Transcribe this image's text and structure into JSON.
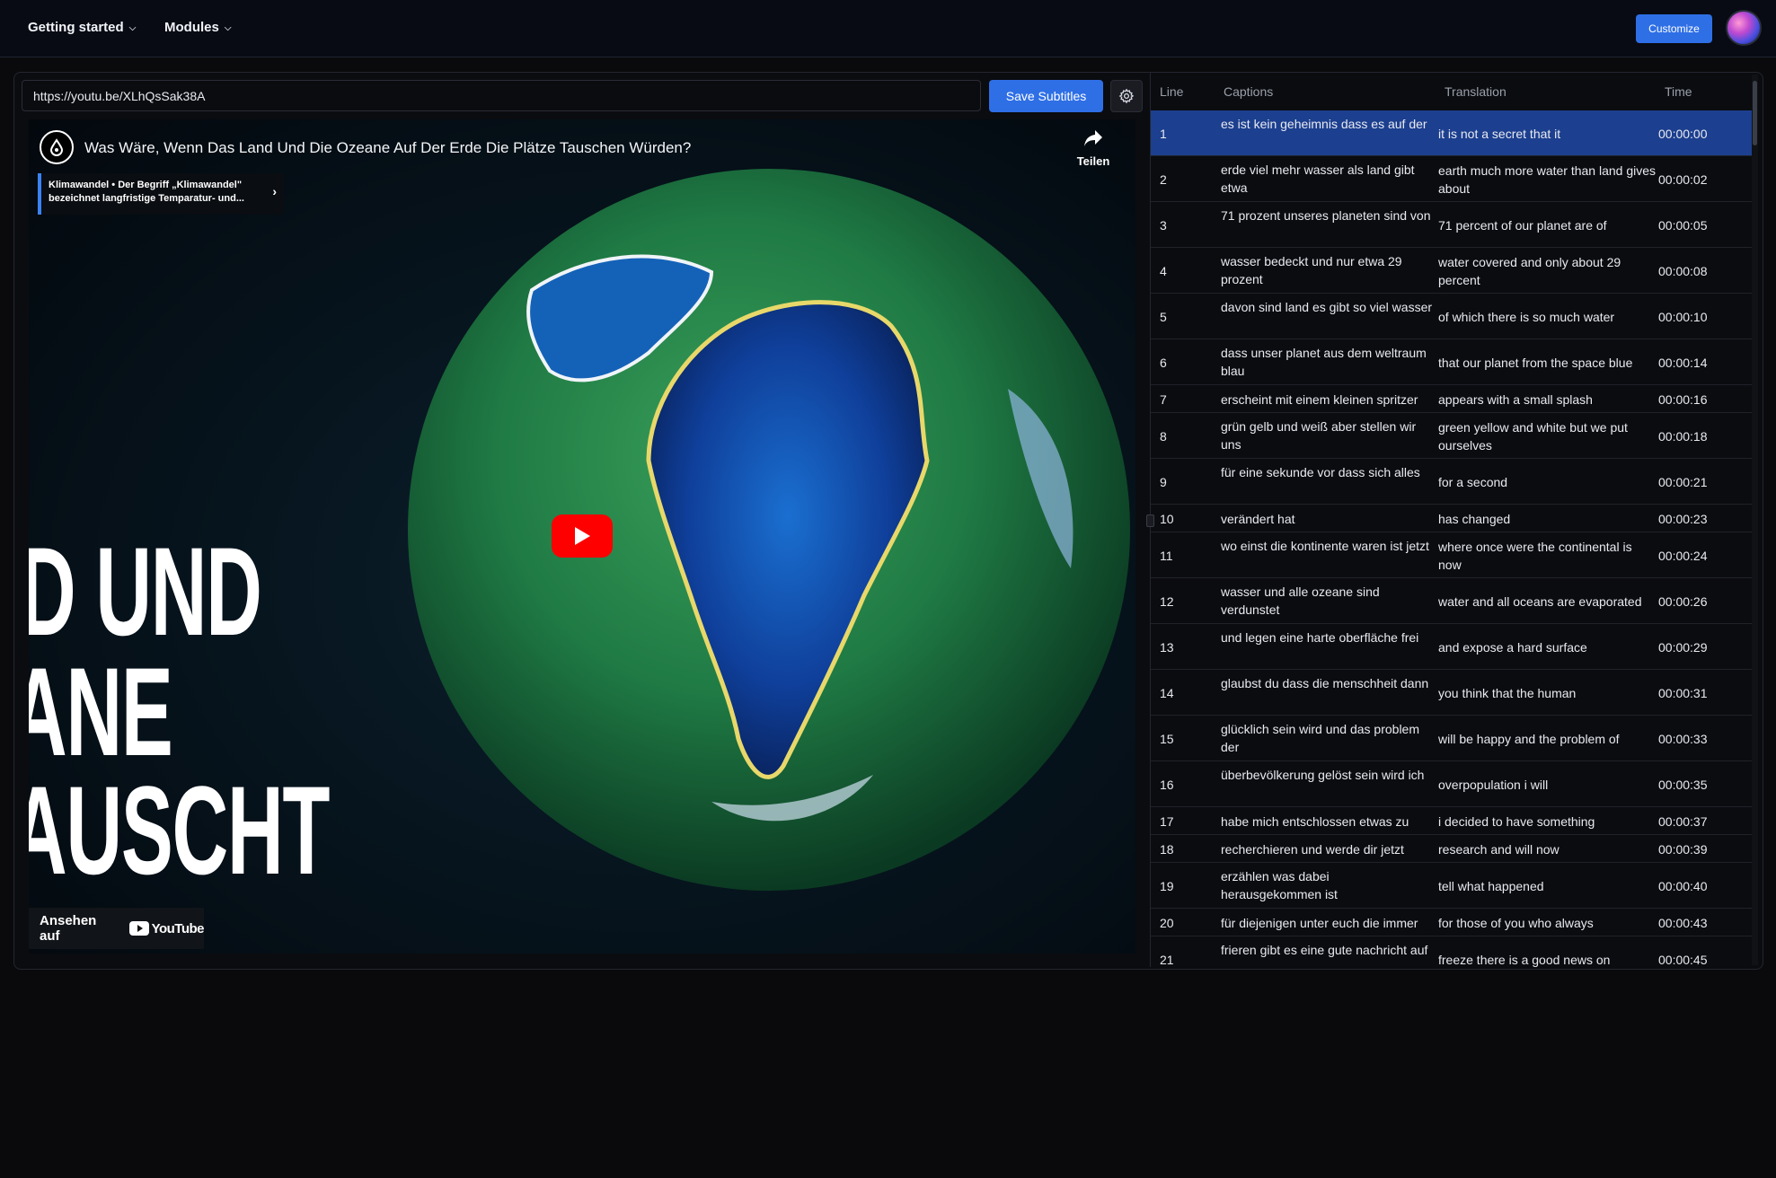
{
  "nav": {
    "items": [
      {
        "label": "Getting started",
        "icon": "chevron-down"
      },
      {
        "label": "Modules",
        "icon": "chevron-down"
      }
    ],
    "customize_label": "Customize"
  },
  "toolbar": {
    "url_value": "https://youtu.be/XLhQsSak38A",
    "save_label": "Save Subtitles",
    "settings_icon": "gear-icon"
  },
  "video": {
    "title": "Was Wäre, Wenn Das Land Und Die Ozeane Auf Der Erde Die Plätze Tauschen Würden?",
    "share_label": "Teilen",
    "info_card": "Klimawandel • Der Begriff „Klimawandel\" bezeichnet langfristige Temparatur- und...",
    "thumbnail_text": [
      "D UND",
      "ANE",
      "AUSCHT"
    ],
    "watch_on_label": "Ansehen auf",
    "youtube_word": "YouTube",
    "play_color": "#ff0000"
  },
  "table": {
    "headers": {
      "line": "Line",
      "captions": "Captions",
      "translation": "Translation",
      "time": "Time"
    },
    "selected_line": 1,
    "rows": [
      {
        "line": "1",
        "caption": "es ist kein geheimnis dass es auf der",
        "translation": "it is not a secret that it",
        "time": "00:00:00"
      },
      {
        "line": "2",
        "caption": "erde viel mehr wasser als land gibt etwa",
        "translation": "earth much more water than land gives about",
        "time": "00:00:02"
      },
      {
        "line": "3",
        "caption": "71 prozent unseres planeten sind von",
        "translation": "71 percent of our planet are of",
        "time": "00:00:05"
      },
      {
        "line": "4",
        "caption": "wasser bedeckt und nur etwa 29 prozent",
        "translation": "water covered and only about 29 percent",
        "time": "00:00:08"
      },
      {
        "line": "5",
        "caption": "davon sind land es gibt so viel wasser",
        "translation": "of which there is so much water",
        "time": "00:00:10"
      },
      {
        "line": "6",
        "caption": "dass unser planet aus dem weltraum blau",
        "translation": "that our planet from the space blue",
        "time": "00:00:14"
      },
      {
        "line": "7",
        "caption": "erscheint mit einem kleinen spritzer",
        "translation": "appears with a small splash",
        "time": "00:00:16"
      },
      {
        "line": "8",
        "caption": "grün gelb und weiß aber stellen wir uns",
        "translation": "green yellow and white but we put ourselves",
        "time": "00:00:18"
      },
      {
        "line": "9",
        "caption": "für eine sekunde vor dass sich alles",
        "translation": "for a second",
        "time": "00:00:21"
      },
      {
        "line": "10",
        "caption": "verändert hat",
        "translation": "has changed",
        "time": "00:00:23"
      },
      {
        "line": "11",
        "caption": "wo einst die kontinente waren ist jetzt",
        "translation": "where once were the continental is now",
        "time": "00:00:24"
      },
      {
        "line": "12",
        "caption": "wasser und alle ozeane sind verdunstet",
        "translation": "water and all oceans are evaporated",
        "time": "00:00:26"
      },
      {
        "line": "13",
        "caption": "und legen eine harte oberfläche frei",
        "translation": "and expose a hard surface",
        "time": "00:00:29"
      },
      {
        "line": "14",
        "caption": "glaubst du dass die menschheit dann",
        "translation": "you think that the human",
        "time": "00:00:31"
      },
      {
        "line": "15",
        "caption": "glücklich sein wird und das problem der",
        "translation": "will be happy and the problem of",
        "time": "00:00:33"
      },
      {
        "line": "16",
        "caption": "überbevölkerung gelöst sein wird ich",
        "translation": "overpopulation i will",
        "time": "00:00:35"
      },
      {
        "line": "17",
        "caption": "habe mich entschlossen etwas zu",
        "translation": "i decided to have something",
        "time": "00:00:37"
      },
      {
        "line": "18",
        "caption": "recherchieren und werde dir jetzt",
        "translation": "research and will now",
        "time": "00:00:39"
      },
      {
        "line": "19",
        "caption": "erzählen was dabei herausgekommen ist",
        "translation": "tell what happened",
        "time": "00:00:40"
      },
      {
        "line": "20",
        "caption": "für diejenigen unter euch die immer",
        "translation": "for those of you who always",
        "time": "00:00:43"
      },
      {
        "line": "21",
        "caption": "frieren gibt es eine gute nachricht auf",
        "translation": "freeze there is a good news on",
        "time": "00:00:45"
      }
    ]
  }
}
